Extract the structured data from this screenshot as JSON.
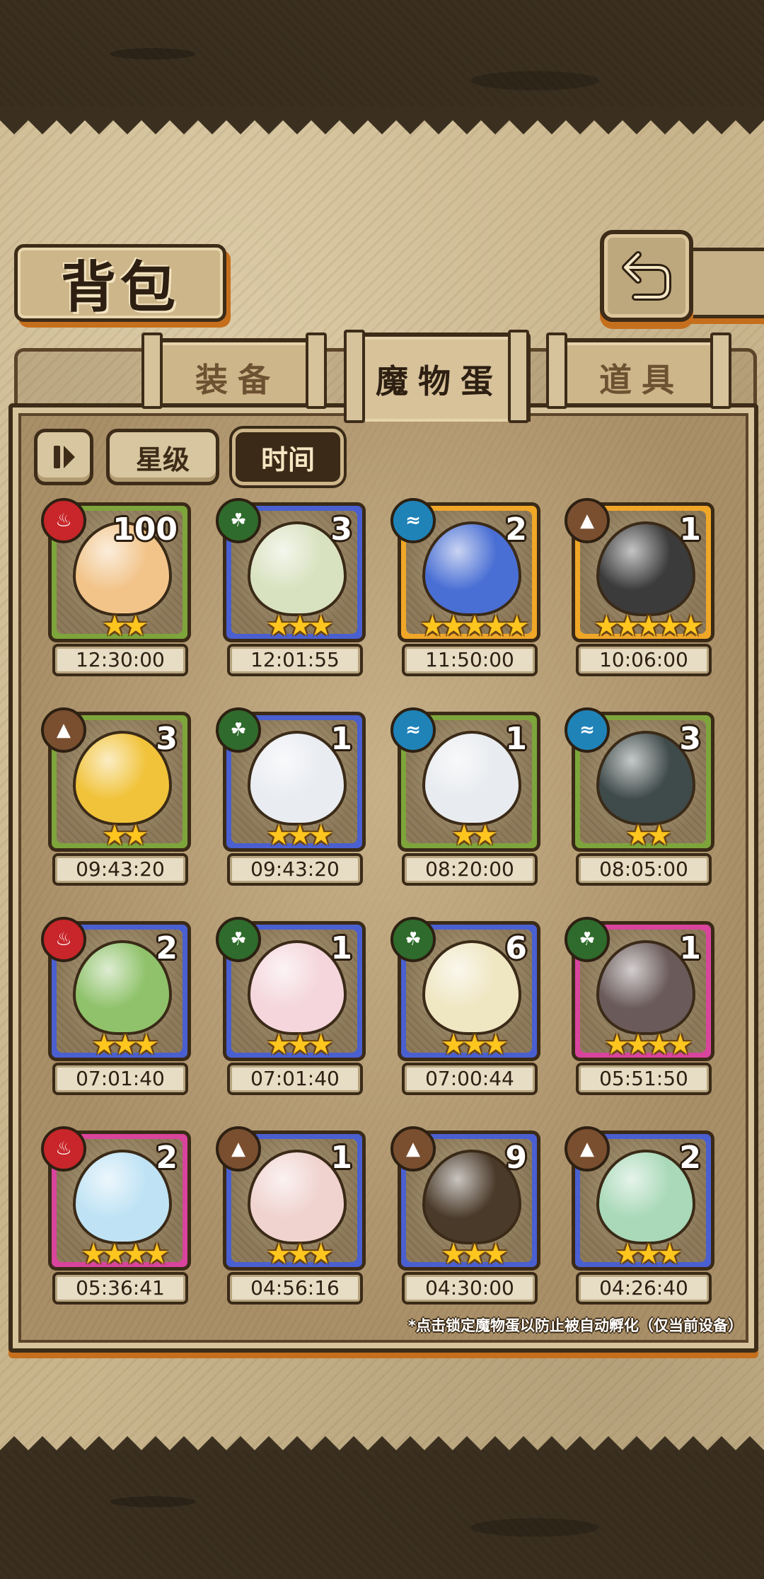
{
  "title": "背包",
  "back_icon": "return-arrow-icon",
  "tabs": [
    {
      "label": "装备",
      "active": false
    },
    {
      "label": "魔物蛋",
      "active": true
    },
    {
      "label": "道具",
      "active": false
    }
  ],
  "sort": {
    "pause_icon": "pause-play-icon",
    "star_label": "星级",
    "time_label": "时间",
    "selected": "时间"
  },
  "eggs": [
    {
      "element": "fire",
      "count": "100",
      "stars": 2,
      "time": "12:30:00",
      "rarity": "green"
    },
    {
      "element": "leaf",
      "count": "3",
      "stars": 3,
      "time": "12:01:55",
      "rarity": "blue"
    },
    {
      "element": "water",
      "count": "2",
      "stars": 5,
      "time": "11:50:00",
      "rarity": "orange"
    },
    {
      "element": "earth",
      "count": "1",
      "stars": 5,
      "time": "10:06:00",
      "rarity": "orange"
    },
    {
      "element": "earth",
      "count": "3",
      "stars": 2,
      "time": "09:43:20",
      "rarity": "green"
    },
    {
      "element": "leaf",
      "count": "1",
      "stars": 3,
      "time": "09:43:20",
      "rarity": "blue"
    },
    {
      "element": "water",
      "count": "1",
      "stars": 2,
      "time": "08:20:00",
      "rarity": "green"
    },
    {
      "element": "water",
      "count": "3",
      "stars": 2,
      "time": "08:05:00",
      "rarity": "green"
    },
    {
      "element": "fire",
      "count": "2",
      "stars": 3,
      "time": "07:01:40",
      "rarity": "blue"
    },
    {
      "element": "leaf",
      "count": "1",
      "stars": 3,
      "time": "07:01:40",
      "rarity": "blue"
    },
    {
      "element": "leaf",
      "count": "6",
      "stars": 3,
      "time": "07:00:44",
      "rarity": "blue"
    },
    {
      "element": "leaf",
      "count": "1",
      "stars": 4,
      "time": "05:51:50",
      "rarity": "pink"
    },
    {
      "element": "fire",
      "count": "2",
      "stars": 4,
      "time": "05:36:41",
      "rarity": "pink"
    },
    {
      "element": "earth",
      "count": "1",
      "stars": 3,
      "time": "04:56:16",
      "rarity": "blue"
    },
    {
      "element": "earth",
      "count": "9",
      "stars": 3,
      "time": "04:30:00",
      "rarity": "blue"
    },
    {
      "element": "earth",
      "count": "2",
      "stars": 3,
      "time": "04:26:40",
      "rarity": "blue"
    }
  ],
  "hint": "*点击锁定魔物蛋以防止被自动孵化（仅当前设备）"
}
